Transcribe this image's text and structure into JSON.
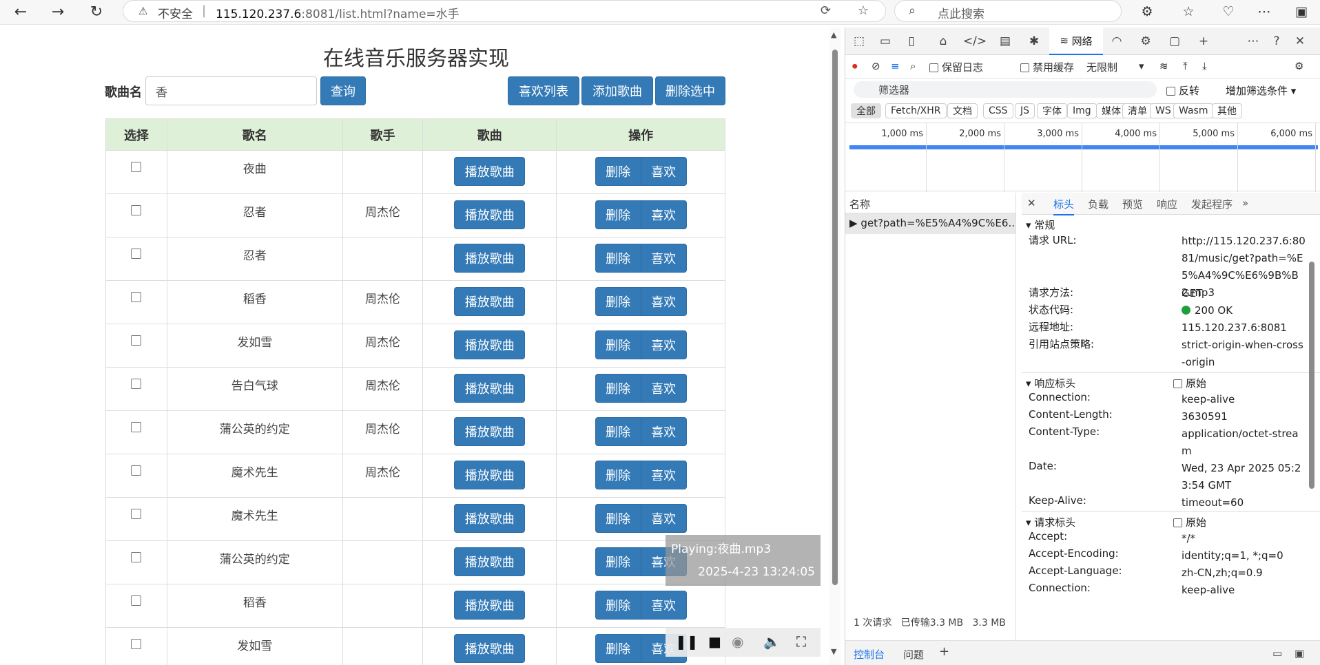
{
  "browser": {
    "back_icon": "arrow-left-icon",
    "insecure_label": "不安全",
    "url_host": "115.120.237.6",
    "url_rest": ":8081/list.html?name=水手",
    "search_placeholder": "点此搜索"
  },
  "page": {
    "title": "在线音乐服务器实现",
    "search_label": "歌曲名",
    "search_value": "香",
    "query_button": "查询",
    "like_list_button": "喜欢列表",
    "add_song_button": "添加歌曲",
    "delete_selected_button": "删除选中",
    "table": {
      "headers": [
        "选择",
        "歌名",
        "歌手",
        "歌曲",
        "操作"
      ],
      "play_label": "播放歌曲",
      "delete_label": "删除",
      "like_label": "喜欢",
      "rows": [
        {
          "title": "夜曲",
          "singer": ""
        },
        {
          "title": "忍者",
          "singer": "周杰伦"
        },
        {
          "title": "忍者",
          "singer": ""
        },
        {
          "title": "稻香",
          "singer": "周杰伦"
        },
        {
          "title": "发如雪",
          "singer": "周杰伦"
        },
        {
          "title": "告白气球",
          "singer": "周杰伦"
        },
        {
          "title": "蒲公英的约定",
          "singer": "周杰伦"
        },
        {
          "title": "魔术先生",
          "singer": "周杰伦"
        },
        {
          "title": "魔术先生",
          "singer": ""
        },
        {
          "title": "蒲公英的约定",
          "singer": ""
        },
        {
          "title": "稻香",
          "singer": ""
        },
        {
          "title": "发如雪",
          "singer": ""
        }
      ]
    }
  },
  "media": {
    "playing": "Playing:夜曲.mp3",
    "time": "2025-4-23 13:24:05"
  },
  "devtools": {
    "network_tab": "网络",
    "preserve_log": "保留日志",
    "disable_cache": "禁用缓存",
    "throttle": "无限制",
    "filter_placeholder": "筛选器",
    "invert": "反转",
    "more_filters": "增加筛选条件",
    "type_filters": [
      "全部",
      "Fetch/XHR",
      "文档",
      "CSS",
      "JS",
      "字体",
      "Img",
      "媒体",
      "清单",
      "WS",
      "Wasm",
      "其他"
    ],
    "timeline_ticks": [
      "1,000 ms",
      "2,000 ms",
      "3,000 ms",
      "4,000 ms",
      "5,000 ms",
      "6,000 ms"
    ],
    "name_header": "名称",
    "request_name": "get?path=%E5%A4%9C%E6...",
    "detail_tabs": [
      "标头",
      "负载",
      "预览",
      "响应",
      "发起程序"
    ],
    "general_section": "▾ 常规",
    "general": {
      "url_key": "请求 URL:",
      "url_val": "http://115.120.237.6:8081/music/get?path=%E5%A4%9C%E6%9B%B2.mp3",
      "method_key": "请求方法:",
      "method_val": "GET",
      "status_key": "状态代码:",
      "status_val": "200 OK",
      "remote_key": "远程地址:",
      "remote_val": "115.120.237.6:8081",
      "referrer_key": "引用站点策略:",
      "referrer_val": "strict-origin-when-cross-origin"
    },
    "response_section": "▾ 响应标头",
    "raw_label": "原始",
    "response_headers": [
      {
        "k": "Connection:",
        "v": "keep-alive"
      },
      {
        "k": "Content-Length:",
        "v": "3630591"
      },
      {
        "k": "Content-Type:",
        "v": "application/octet-stream"
      },
      {
        "k": "Date:",
        "v": "Wed, 23 Apr 2025 05:23:54 GMT"
      },
      {
        "k": "Keep-Alive:",
        "v": "timeout=60"
      }
    ],
    "request_section": "▾ 请求标头",
    "request_headers": [
      {
        "k": "Accept:",
        "v": "*/*"
      },
      {
        "k": "Accept-Encoding:",
        "v": "identity;q=1, *;q=0"
      },
      {
        "k": "Accept-Language:",
        "v": "zh-CN,zh;q=0.9"
      },
      {
        "k": "Connection:",
        "v": "keep-alive"
      }
    ],
    "footer_requests": "1 次请求",
    "footer_transferred": "已传输3.3 MB",
    "footer_size": "3.3 MB",
    "console_tab": "控制台",
    "issues_tab": "问题"
  }
}
